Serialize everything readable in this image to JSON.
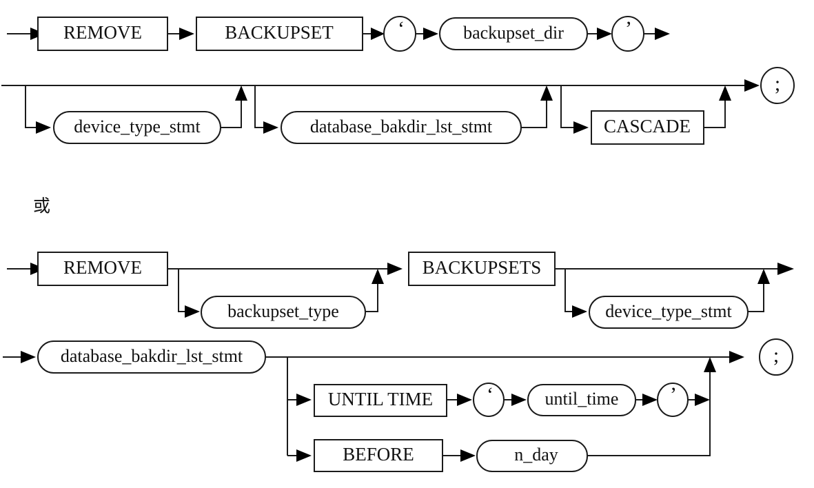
{
  "diagram": {
    "type": "railroad-syntax-diagram",
    "connector_label": "或",
    "colors": {
      "line": "#1a1a1a",
      "text": "#111111",
      "background": "#ffffff",
      "arrow": "#000000"
    },
    "alternatives": [
      {
        "id": "remove-backupset",
        "rows": [
          {
            "id": "row-1",
            "nodes": [
              {
                "kind": "box",
                "label": "REMOVE"
              },
              {
                "kind": "box",
                "label": "BACKUPSET"
              },
              {
                "kind": "circle",
                "label": "‘"
              },
              {
                "kind": "oval",
                "label": "backupset_dir"
              },
              {
                "kind": "circle",
                "label": "’"
              }
            ]
          },
          {
            "id": "row-2",
            "optional_nodes": [
              {
                "kind": "oval",
                "label": "device_type_stmt"
              },
              {
                "kind": "oval",
                "label": "database_bakdir_lst_stmt"
              },
              {
                "kind": "box",
                "label": "CASCADE"
              }
            ],
            "terminator": {
              "kind": "circle",
              "label": ";"
            }
          }
        ]
      },
      {
        "id": "remove-backupsets",
        "rows": [
          {
            "id": "row-3",
            "nodes": [
              {
                "kind": "box",
                "label": "REMOVE"
              },
              {
                "kind": "box",
                "label": "BACKUPSETS"
              }
            ],
            "optional_nodes": [
              {
                "kind": "oval",
                "label": "backupset_type"
              },
              {
                "kind": "oval",
                "label": "device_type_stmt"
              }
            ]
          },
          {
            "id": "row-4",
            "nodes": [
              {
                "kind": "oval",
                "label": "database_bakdir_lst_stmt"
              }
            ],
            "branches": [
              {
                "id": "until-time-branch",
                "nodes": [
                  {
                    "kind": "box",
                    "label": "UNTIL TIME"
                  },
                  {
                    "kind": "circle",
                    "label": "‘"
                  },
                  {
                    "kind": "oval",
                    "label": "until_time"
                  },
                  {
                    "kind": "circle",
                    "label": "’"
                  }
                ]
              },
              {
                "id": "before-branch",
                "nodes": [
                  {
                    "kind": "box",
                    "label": "BEFORE"
                  },
                  {
                    "kind": "oval",
                    "label": "n_day"
                  }
                ]
              }
            ],
            "terminator": {
              "kind": "circle",
              "label": ";"
            }
          }
        ]
      }
    ],
    "labels": {
      "remove_1": "REMOVE",
      "backupset": "BACKUPSET",
      "quote_open_1": "‘",
      "backupset_dir": "backupset_dir",
      "quote_close_1": "’",
      "device_type_stmt_1": "device_type_stmt",
      "database_bakdir_lst_stmt_1": "database_bakdir_lst_stmt",
      "cascade": "CASCADE",
      "semicolon_1": ";",
      "or_text": "或",
      "remove_2": "REMOVE",
      "backupset_type": "backupset_type",
      "backupsets": "BACKUPSETS",
      "device_type_stmt_2": "device_type_stmt",
      "database_bakdir_lst_stmt_2": "database_bakdir_lst_stmt",
      "until_time_kw": "UNTIL TIME",
      "quote_open_2": "‘",
      "until_time_var": "until_time",
      "quote_close_2": "’",
      "before_kw": "BEFORE",
      "n_day": "n_day",
      "semicolon_2": ";"
    }
  }
}
